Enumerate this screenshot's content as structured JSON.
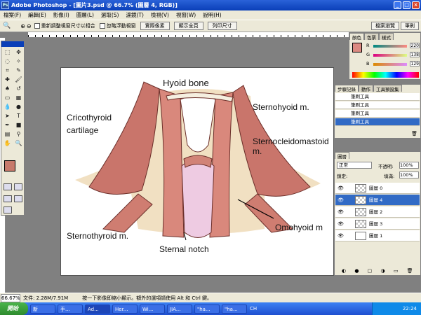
{
  "window": {
    "title": "Adobe Photoshop - [圖片3.psd @ 66.7% (圖層 4, RGB)]"
  },
  "menu": [
    "檔案(F)",
    "編輯(E)",
    "影像(I)",
    "圖層(L)",
    "選取(S)",
    "濾鏡(T)",
    "檢視(V)",
    "視窗(W)",
    "說明(H)"
  ],
  "options": {
    "chk1": "重新調整視窗尺寸以相合",
    "chk2": "忽略浮動視窗",
    "btn1": "實際像素",
    "btn2": "顯示全頁",
    "btn3": "列印尺寸",
    "dock1": "檔案瀏覽",
    "dock2": "筆刷"
  },
  "canvas_labels": {
    "hyoid": "Hyoid bone",
    "crico1": "Cricothyroid",
    "crico2": "cartilage",
    "sternohyoid": "Sternohyoid m.",
    "scm": "Sternocleidomastoid m.",
    "omohyoid": "Omohyoid m",
    "sternothyroid": "Sternothyroid m.",
    "notch": "Sternal notch"
  },
  "color_panel": {
    "tabs": [
      "顏色",
      "色票",
      "樣式"
    ],
    "channels": [
      {
        "label": "R",
        "value": "220"
      },
      {
        "label": "G",
        "value": "138"
      },
      {
        "label": "B",
        "value": "129"
      }
    ],
    "fg_color": "#dc8a81"
  },
  "history_panel": {
    "tabs": [
      "步驟記錄",
      "動作",
      "工具預設集"
    ],
    "items": [
      "筆刷工具",
      "筆刷工具",
      "筆刷工具",
      "筆刷工具"
    ]
  },
  "layers_panel": {
    "tab": "圖層",
    "mode": "正常",
    "opacity_label": "不透明:",
    "opacity": "100%",
    "lock_label": "鎖定:",
    "fill_label": "填滿:",
    "fill": "100%",
    "layers": [
      "圖層 0",
      "圖層 4",
      "圖層 2",
      "圖層 3",
      "圖層 1"
    ]
  },
  "status": {
    "zoom": "66.67%",
    "doc": "文件: 2.28M/7.91M",
    "hint": "按一下影像即縮小顯示。額外的選項請使用 Alt 和 Ctrl 鍵。"
  },
  "taskbar": {
    "start": "開始",
    "tasks": [
      "新",
      "手...",
      "Ad...",
      "Her...",
      "Wi...",
      "JIA...",
      "\"ha...",
      "\"ha...",
      "CH"
    ],
    "clock": "22:24"
  }
}
